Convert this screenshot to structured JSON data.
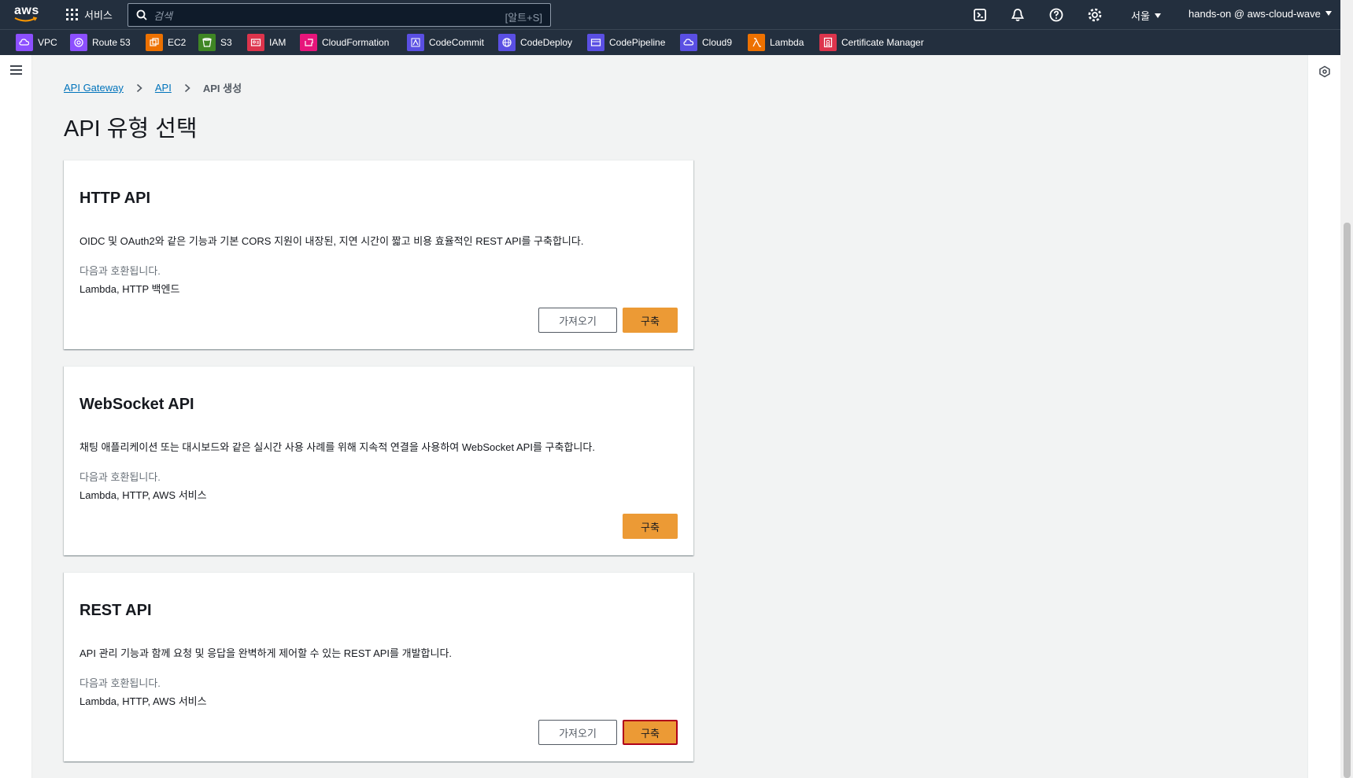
{
  "topnav": {
    "logo_text": "aws",
    "services_label": "서비스",
    "search_placeholder": "검색",
    "search_shortcut": "[알트+S]",
    "region": "서울",
    "account": "hands-on @ aws-cloud-wave",
    "icons": [
      "cloudshell-icon",
      "bell-icon",
      "help-icon",
      "gear-icon"
    ]
  },
  "favorites": [
    {
      "label": "VPC",
      "color": "#8c4fff"
    },
    {
      "label": "Route 53",
      "color": "#8c4fff"
    },
    {
      "label": "EC2",
      "color": "#ed7100"
    },
    {
      "label": "S3",
      "color": "#3f8624"
    },
    {
      "label": "IAM",
      "color": "#dd344c"
    },
    {
      "label": "CloudFormation",
      "color": "#e7157b"
    },
    {
      "label": "CodeCommit",
      "color": "#5a4fe3"
    },
    {
      "label": "CodeDeploy",
      "color": "#5a4fe3"
    },
    {
      "label": "CodePipeline",
      "color": "#5a4fe3"
    },
    {
      "label": "Cloud9",
      "color": "#5a4fe3"
    },
    {
      "label": "Lambda",
      "color": "#ed7100"
    },
    {
      "label": "Certificate Manager",
      "color": "#dd344c"
    }
  ],
  "breadcrumb": {
    "items": [
      "API Gateway",
      "API"
    ],
    "current": "API 생성"
  },
  "page_title": "API 유형 선택",
  "cards": [
    {
      "title": "HTTP API",
      "description": "OIDC 및 OAuth2와 같은 기능과 기본 CORS 지원이 내장된, 지연 시간이 짧고 비용 효율적인 REST API를 구축합니다.",
      "compat_label": "다음과 호환됩니다.",
      "compat_targets": "Lambda, HTTP 백엔드",
      "import_label": "가져오기",
      "build_label": "구축"
    },
    {
      "title": "WebSocket API",
      "description": "채팅 애플리케이션 또는 대시보드와 같은 실시간 사용 사례를 위해 지속적 연결을 사용하여 WebSocket API를 구축합니다.",
      "compat_label": "다음과 호환됩니다.",
      "compat_targets": "Lambda, HTTP, AWS 서비스",
      "build_label": "구축"
    },
    {
      "title": "REST API",
      "description": "API 관리 기능과 함께 요청 및 응답을 완벽하게 제어할 수 있는 REST API를 개발합니다.",
      "compat_label": "다음과 호환됩니다.",
      "compat_targets": "Lambda, HTTP, AWS 서비스",
      "import_label": "가져오기",
      "build_label": "구축"
    }
  ]
}
